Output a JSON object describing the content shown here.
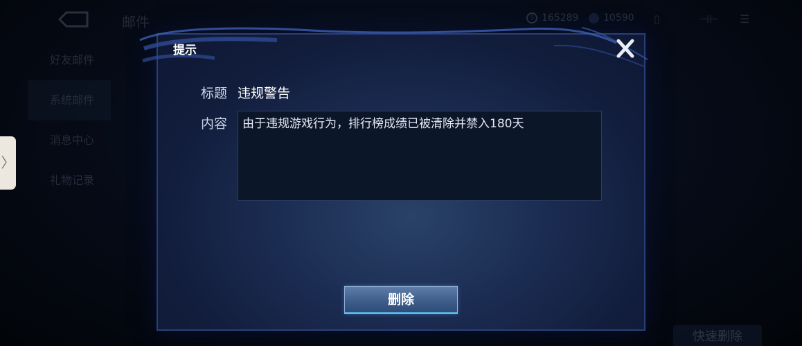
{
  "background": {
    "page_title": "邮件",
    "currencies": [
      {
        "icon": "coin-icon",
        "value": "165289"
      },
      {
        "icon": "gem-icon",
        "value": "10590"
      }
    ],
    "sidebar": [
      {
        "label": "好友邮件",
        "active": false
      },
      {
        "label": "系统邮件",
        "active": true
      },
      {
        "label": "消息中心",
        "active": false
      },
      {
        "label": "礼物记录",
        "active": false
      }
    ],
    "quick_delete_label": "快速删除"
  },
  "side_handle": {
    "glyph": "〉"
  },
  "dialog": {
    "header": "提示",
    "subject_label": "标题",
    "subject_value": "违规警告",
    "content_label": "内容",
    "content_value": "由于违规游戏行为，排行榜成绩已被清除并禁入180天",
    "delete_label": "删除",
    "close_icon": "close-icon"
  },
  "colors": {
    "dialog_bg": "#1b2c52",
    "dialog_border": "#2a3f78",
    "button_bg": "#3e5d8a",
    "button_border": "#8fb2dd"
  }
}
